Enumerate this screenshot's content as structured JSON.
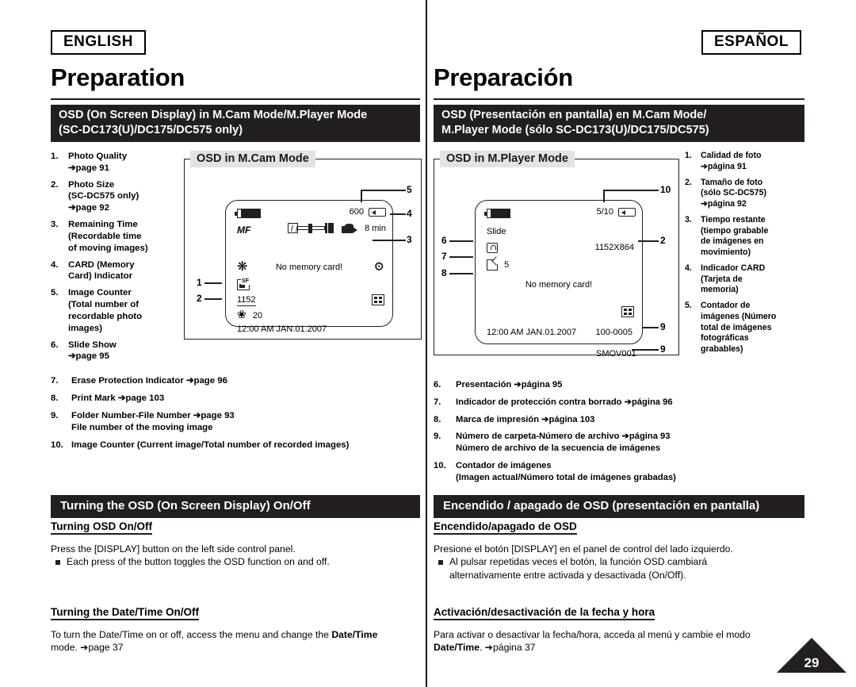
{
  "english": {
    "lang_label": "ENGLISH",
    "chapter": "Preparation",
    "banner_line1": "OSD (On Screen Display) in M.Cam Mode/M.Player Mode",
    "banner_line2": "(SC-DC173(U)/DC175/DC575 only)",
    "diagram_title": "OSD in M.Cam Mode",
    "list_top": [
      {
        "n": "1.",
        "lines": [
          "Photo Quality",
          "➔page 91"
        ]
      },
      {
        "n": "2.",
        "lines": [
          "Photo Size",
          "(SC-DC575 only)",
          "➔page 92"
        ]
      },
      {
        "n": "3.",
        "lines": [
          "Remaining Time",
          "(Recordable time",
          "of moving images)"
        ]
      },
      {
        "n": "4.",
        "lines": [
          "CARD (Memory",
          "Card) Indicator"
        ]
      },
      {
        "n": "5.",
        "lines": [
          "Image Counter",
          "(Total number of",
          "recordable photo",
          "images)"
        ]
      },
      {
        "n": "6.",
        "lines": [
          "Slide Show",
          "➔page 95"
        ]
      }
    ],
    "list_bottom": [
      {
        "n": "7.",
        "lines": [
          "Erase Protection Indicator ➔page 96"
        ]
      },
      {
        "n": "8.",
        "lines": [
          "Print Mark ➔page 103"
        ]
      },
      {
        "n": "9.",
        "lines": [
          "Folder Number-File Number ➔page 93",
          "File number of the moving image"
        ]
      },
      {
        "n": "10.",
        "lines": [
          "Image Counter (Current image/Total number of recorded images)"
        ]
      }
    ],
    "section2_banner": "Turning the OSD (On Screen Display) On/Off",
    "sub1_title": "Turning OSD On/Off",
    "sub1_line": "Press the [DISPLAY] button on the left side control panel.",
    "sub1_bullet": "Each press of the button toggles the OSD function on and off.",
    "sub2_title": "Turning the Date/Time On/Off",
    "sub2_line_a": "To turn the Date/Time on or off, access the menu and change the ",
    "sub2_line_b": "Date/Time",
    "sub2_line_c": "mode. ➔page 37"
  },
  "spanish": {
    "lang_label": "ESPAÑOL",
    "chapter": "Preparación",
    "banner_line1": "OSD (Presentación en pantalla) en M.Cam Mode/",
    "banner_line2": "M.Player Mode (sólo  SC-DC173(U)/DC175/DC575)",
    "diagram_title": "OSD in M.Player Mode",
    "list_top": [
      {
        "n": "1.",
        "lines": [
          "Calidad de foto",
          "➔página 91"
        ]
      },
      {
        "n": "2.",
        "lines": [
          "Tamaño de foto",
          "(sólo SC-DC575)",
          "➔página 92"
        ]
      },
      {
        "n": "3.",
        "lines": [
          "Tiempo restante",
          "(tiempo grabable",
          "de imágenes en",
          "movimiento)"
        ]
      },
      {
        "n": "4.",
        "lines": [
          "Indicador CARD",
          "(Tarjeta de",
          "memoria)"
        ]
      },
      {
        "n": "5.",
        "lines": [
          "Contador de",
          "imágenes (Número",
          "total de imágenes",
          "fotográficas",
          "grabables)"
        ]
      }
    ],
    "list_bottom": [
      {
        "n": "6.",
        "lines": [
          "Presentación ➔página 95"
        ]
      },
      {
        "n": "7.",
        "lines": [
          "Indicador de protección contra borrado ➔página 96"
        ]
      },
      {
        "n": "8.",
        "lines": [
          "Marca de impresión ➔página 103"
        ]
      },
      {
        "n": "9.",
        "lines": [
          "Número de carpeta-Número de archivo ➔página 93",
          "Número de archivo de la secuencia de imágenes"
        ]
      },
      {
        "n": "10.",
        "lines": [
          "Contador de imágenes",
          "(Imagen actual/Número total de imágenes grabadas)"
        ]
      }
    ],
    "section2_banner": "Encendido / apagado de OSD (presentación en pantalla)",
    "sub1_title": "Encendido/apagado de OSD",
    "sub1_line": "Presione el botón [DISPLAY] en el panel de control del lado izquierdo.",
    "sub1_bullet_a": "Al pulsar repetidas veces el botón, la función OSD cambiará",
    "sub1_bullet_b": "alternativamente entre activada y desactivada (On/Off).",
    "sub2_title": "Activación/desactivación de la fecha y hora",
    "sub2_line_a": "Para activar o desactivar la fecha/hora, acceda al menú y cambie el modo",
    "sub2_line_b": "Date/Time",
    "sub2_line_c": ". ➔página 37"
  },
  "mcam_screen": {
    "photo_count": "600",
    "remaining_time": "8 min",
    "no_card_message": "No memory card!",
    "focus_mode": "MF",
    "image_counter": "1152",
    "aperture_value": "20",
    "datetime": "12:00 AM JAN.01.2007",
    "callouts": [
      "1",
      "2",
      "3",
      "4",
      "5"
    ]
  },
  "mplayer_screen": {
    "image_index": "5/10",
    "slide_label": "Slide",
    "print_count": "5",
    "resolution": "1152X864",
    "no_card_message": "No memory card!",
    "datetime": "12:00 AM JAN.01.2007",
    "folder_file": "100-0005",
    "movie_file": "SMOV001",
    "callouts": [
      "2",
      "6",
      "7",
      "8",
      "9",
      "9",
      "10"
    ]
  },
  "page_number": "29",
  "colors": {
    "banner_bg": "#231f20",
    "diagram_title_bg": "#e3e3e3",
    "text": "#000000"
  }
}
